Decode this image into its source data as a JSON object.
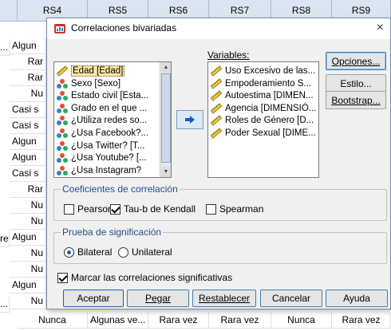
{
  "sheet": {
    "columns": [
      "RS4",
      "RS5",
      "RS6",
      "RS7",
      "RS8",
      "RS9"
    ],
    "left_cells": [
      "Algun",
      "Rar",
      "Rar",
      "Nu",
      "Casi s",
      "Casi s",
      "Algun",
      "Algun",
      "Casi s",
      "Rar",
      "Nu",
      "Nu",
      "Algun",
      "Nu",
      "Nu",
      "Algun",
      "Nu"
    ],
    "side_fragments": [
      "...",
      "re",
      "..."
    ],
    "bottom_row": [
      "Nunca",
      "Algunas ve...",
      "Rara vez",
      "Rara vez",
      "Nunca",
      "Rara vez"
    ]
  },
  "dialog": {
    "title": "Correlaciones bivariadas",
    "close_glyph": "×",
    "source_items": [
      {
        "label": "Edad [Edad]",
        "icon": "scale-ruler-icon",
        "selected": true
      },
      {
        "label": "Sexo [Sexo]",
        "icon": "nominal-icon",
        "selected": false
      },
      {
        "label": "Estado civil [Esta...",
        "icon": "nominal-icon",
        "selected": false
      },
      {
        "label": "Grado en el que ...",
        "icon": "nominal-icon",
        "selected": false
      },
      {
        "label": "¿Utiliza redes so...",
        "icon": "nominal-icon",
        "selected": false
      },
      {
        "label": "¿Usa Facebook?...",
        "icon": "nominal-icon",
        "selected": false
      },
      {
        "label": "¿Usa Twitter? [T...",
        "icon": "nominal-icon",
        "selected": false
      },
      {
        "label": "¿Usa Youtube? [...",
        "icon": "nominal-icon",
        "selected": false
      },
      {
        "label": "¿Usa Instagram?",
        "icon": "nominal-icon",
        "selected": false
      }
    ],
    "variables_label": "Variables:",
    "variables_items": [
      {
        "label": "Uso Excesivo de las...",
        "icon": "scale-ruler-icon"
      },
      {
        "label": "Empoderamiento S...",
        "icon": "scale-ruler-icon"
      },
      {
        "label": "Autoestima [DIMEN...",
        "icon": "scale-ruler-icon"
      },
      {
        "label": "Agencia [DIMENSIÓ...",
        "icon": "scale-ruler-icon"
      },
      {
        "label": "Roles de Género [D...",
        "icon": "scale-ruler-icon"
      },
      {
        "label": "Poder Sexual [DIME...",
        "icon": "scale-ruler-icon"
      }
    ],
    "side_buttons": [
      "Opciones...",
      "Estilo...",
      "Bootstrap..."
    ],
    "coef_group": {
      "legend": "Coeficientes de correlación",
      "options": [
        {
          "label": "Pearson",
          "checked": false
        },
        {
          "label": "Tau-b de Kendall",
          "checked": true
        },
        {
          "label": "Spearman",
          "checked": false
        }
      ]
    },
    "sig_group": {
      "legend": "Prueba de significación",
      "options": [
        {
          "label": "Bilateral",
          "checked": true
        },
        {
          "label": "Unilateral",
          "checked": false
        }
      ]
    },
    "flag_label": "Marcar las correlaciones significativas",
    "flag_checked": true,
    "bottom_buttons": [
      "Aceptar",
      "Pegar",
      "Restablecer",
      "Cancelar",
      "Ayuda"
    ]
  },
  "colors": {
    "header_bg": "#dbe5f1",
    "selected_bg": "#fdeaa0",
    "group_legend": "#1f4e8c",
    "button_border": "#3c7fb1"
  }
}
